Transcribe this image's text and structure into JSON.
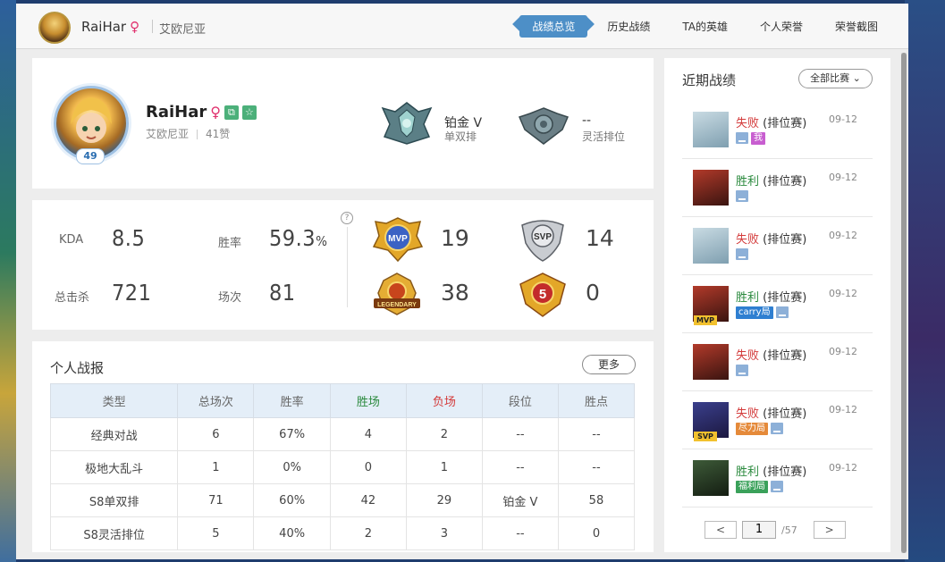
{
  "header": {
    "name": "RaiHar",
    "gender_symbol": "♀",
    "region": "艾欧尼亚",
    "tabs": [
      "战绩总览",
      "历史战绩",
      "TA的英雄",
      "个人荣誉",
      "荣誉截图"
    ],
    "active_tab": "战绩总览"
  },
  "profile": {
    "name": "RaiHar",
    "gender_symbol": "♀",
    "region": "艾欧尼亚",
    "likes": "41赞",
    "level": "49",
    "solo_rank": "铂金 V",
    "solo_label": "单双排",
    "flex_rank": "--",
    "flex_label": "灵活排位",
    "icon_copy": "⧉",
    "icon_star": "☆"
  },
  "stats": {
    "kda_label": "KDA",
    "kda": "8.5",
    "winrate_label": "胜率",
    "winrate": "59.3",
    "winrate_unit": "%",
    "kills_label": "总击杀",
    "kills": "721",
    "games_label": "场次",
    "games": "81",
    "help": "?",
    "mvp": "19",
    "svp": "14",
    "legendary": "38",
    "penta": "0",
    "mvp_badge": "MVP",
    "svp_badge": "SVP",
    "legendary_badge": "LEGENDARY",
    "penta_badge": "5"
  },
  "report": {
    "title": "个人战报",
    "more": "更多",
    "headers": [
      "类型",
      "总场次",
      "胜率",
      "胜场",
      "负场",
      "段位",
      "胜点"
    ],
    "rows": [
      [
        "经典对战",
        "6",
        "67%",
        "4",
        "2",
        "--",
        "--"
      ],
      [
        "极地大乱斗",
        "1",
        "0%",
        "0",
        "1",
        "--",
        "--"
      ],
      [
        "S8单双排",
        "71",
        "60%",
        "42",
        "29",
        "铂金 V",
        "58"
      ],
      [
        "S8灵活排位",
        "5",
        "40%",
        "2",
        "3",
        "--",
        "0"
      ]
    ]
  },
  "recent": {
    "title": "近期战绩",
    "filter": "全部比赛",
    "matches": [
      {
        "result": "失败",
        "mode": "(排位赛)",
        "date": "09-12",
        "tags": [
          "我"
        ],
        "badge": ""
      },
      {
        "result": "胜利",
        "mode": "(排位赛)",
        "date": "09-12",
        "tags": [],
        "badge": ""
      },
      {
        "result": "失败",
        "mode": "(排位赛)",
        "date": "09-12",
        "tags": [],
        "badge": ""
      },
      {
        "result": "胜利",
        "mode": "(排位赛)",
        "date": "09-12",
        "tags": [
          "carry局"
        ],
        "badge": "MVP"
      },
      {
        "result": "失败",
        "mode": "(排位赛)",
        "date": "09-12",
        "tags": [],
        "badge": ""
      },
      {
        "result": "失败",
        "mode": "(排位赛)",
        "date": "09-12",
        "tags": [
          "尽力局"
        ],
        "badge": "SVP"
      },
      {
        "result": "胜利",
        "mode": "(排位赛)",
        "date": "09-12",
        "tags": [
          "福利局"
        ],
        "badge": ""
      }
    ],
    "page": "1",
    "total_pages": "/57"
  },
  "colors": {
    "accent": "#4d8fc7",
    "win": "#2b8a3e",
    "loss": "#d33a3a",
    "tag_me": "#c85ed0",
    "tag_carry": "#2f7fd1",
    "tag_effort": "#e58a3a",
    "tag_welfare": "#3aa15a"
  }
}
